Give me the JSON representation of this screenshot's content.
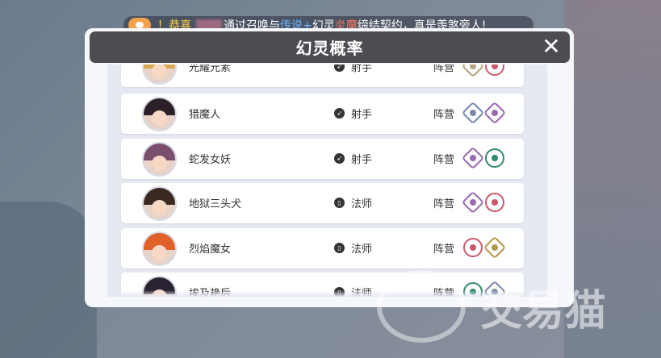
{
  "banner": {
    "prefix": "！恭喜",
    "middle": "通过召唤与",
    "highlight": "传说+",
    "suffix1": "幻灵",
    "red": "炎魔",
    "suffix2": "缔结契约，真是羡煞旁人!"
  },
  "dialog": {
    "title": "幻灵概率",
    "close_label": "✕"
  },
  "rows": [
    {
      "name": "光耀元素",
      "cls": "射手",
      "cls_icon": "bow-icon",
      "faction_label": "阵营",
      "hair": "#d9a94f",
      "f1": {
        "shape": "diamond",
        "color": "#b5a47a"
      },
      "f2": {
        "shape": "circle",
        "color": "#c85a6a"
      }
    },
    {
      "name": "猎魔人",
      "cls": "射手",
      "cls_icon": "bow-icon",
      "faction_label": "阵营",
      "hair": "#2b2028",
      "f1": {
        "shape": "diamond",
        "color": "#7a8aa8"
      },
      "f2": {
        "shape": "diamond",
        "color": "#9a6ab0"
      }
    },
    {
      "name": "蛇发女妖",
      "cls": "射手",
      "cls_icon": "bow-icon",
      "faction_label": "阵营",
      "hair": "#7a4f6e",
      "f1": {
        "shape": "diamond",
        "color": "#9a6ab0"
      },
      "f2": {
        "shape": "circle",
        "color": "#2f8a6a"
      }
    },
    {
      "name": "地狱三头犬",
      "cls": "法师",
      "cls_icon": "book-icon",
      "faction_label": "阵营",
      "hair": "#3a2a22",
      "f1": {
        "shape": "diamond",
        "color": "#9a6ab0"
      },
      "f2": {
        "shape": "circle",
        "color": "#c85a6a"
      }
    },
    {
      "name": "烈焰魔女",
      "cls": "法师",
      "cls_icon": "book-icon",
      "faction_label": "阵营",
      "hair": "#e0602a",
      "f1": {
        "shape": "circle",
        "color": "#c85a6a"
      },
      "f2": {
        "shape": "diamond",
        "color": "#b59a4a"
      }
    },
    {
      "name": "埃及艳后",
      "cls": "法师",
      "cls_icon": "book-icon",
      "faction_label": "阵营",
      "hair": "#2a2230",
      "f1": {
        "shape": "circle",
        "color": "#2f8a6a"
      },
      "f2": {
        "shape": "diamond",
        "color": "#7a8aa8"
      }
    }
  ],
  "watermark": "交易猫"
}
